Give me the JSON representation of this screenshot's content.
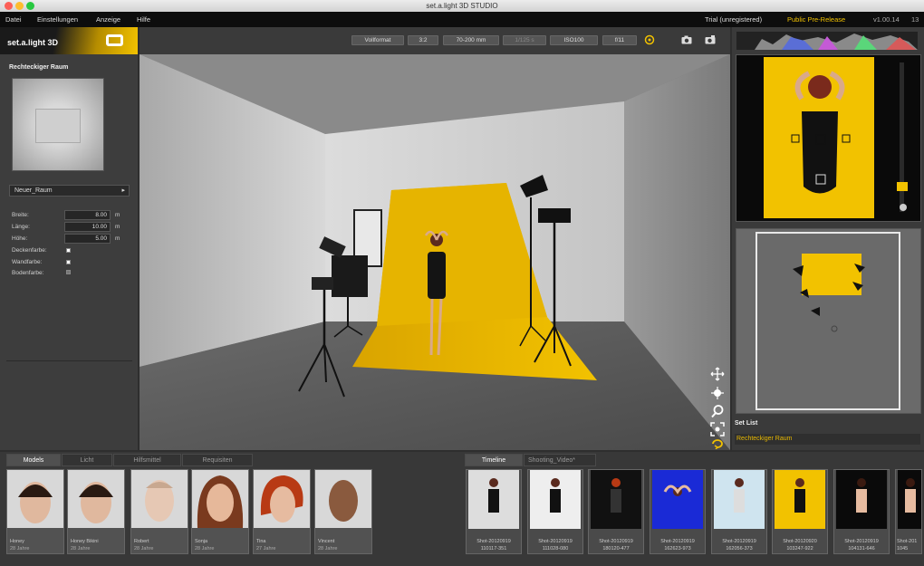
{
  "window": {
    "title": "set.a.light 3D STUDIO"
  },
  "menu": {
    "items": [
      "Datei",
      "Einstellungen",
      "Anzeige",
      "Hilfe"
    ],
    "trial": "Trial (unregistered)",
    "prerelease": "Public Pre-Release",
    "version": "v1.00.14",
    "extra": "13"
  },
  "colors": {
    "accent": "#f2c200",
    "backdrop": "#e6b400"
  },
  "logo": {
    "text": "set.a.light 3D"
  },
  "room": {
    "title": "Rechteckiger Raum",
    "preset": "Neuer_Raum",
    "props": [
      {
        "label": "Breite:",
        "value": "8.00",
        "unit": "m"
      },
      {
        "label": "Länge:",
        "value": "10.00",
        "unit": "m"
      },
      {
        "label": "Höhe:",
        "value": "5.00",
        "unit": "m"
      }
    ],
    "colors": [
      "Deckenfarbe:",
      "Wandfarbe:",
      "Bodenfarbe:"
    ]
  },
  "toolbar": {
    "format": "Vollformat",
    "ratio": "3:2",
    "lens": "70-200 mm",
    "shutter": "1/125 s",
    "iso": "ISO100",
    "aperture": "f/11",
    "icons": [
      "aperture-icon",
      "camera-icon",
      "camera-settings-icon"
    ]
  },
  "setlist": {
    "title": "Set List",
    "items": [
      "Rechteckiger Raum"
    ]
  },
  "bottom_left": {
    "tabs": [
      "Models",
      "Licht",
      "Hilfsmittel",
      "Requisiten"
    ],
    "models": [
      {
        "name": "Honey",
        "age": "28 Jahre"
      },
      {
        "name": "Honey Bikini",
        "age": "28 Jahre"
      },
      {
        "name": "Robert",
        "age": "28 Jahre"
      },
      {
        "name": "Sonja",
        "age": "28 Jahre"
      },
      {
        "name": "Tina",
        "age": "27 Jahre"
      },
      {
        "name": "Vincent",
        "age": "28 Jahre"
      }
    ]
  },
  "bottom_right": {
    "tabs": [
      "Timeline",
      "Shooting_Video*"
    ],
    "shots": [
      {
        "l1": "Shot-20120919",
        "l2": "110117-351"
      },
      {
        "l1": "Shot-20120919",
        "l2": "111028-080"
      },
      {
        "l1": "Shot-20120919",
        "l2": "180120-477"
      },
      {
        "l1": "Shot-20120919",
        "l2": "162623-973"
      },
      {
        "l1": "Shot-20120919",
        "l2": "162056-373"
      },
      {
        "l1": "Shot-20120920",
        "l2": "103247-922"
      },
      {
        "l1": "Shot-20120919",
        "l2": "104131-646"
      },
      {
        "l1": "Shot-201",
        "l2": "1045"
      }
    ]
  }
}
